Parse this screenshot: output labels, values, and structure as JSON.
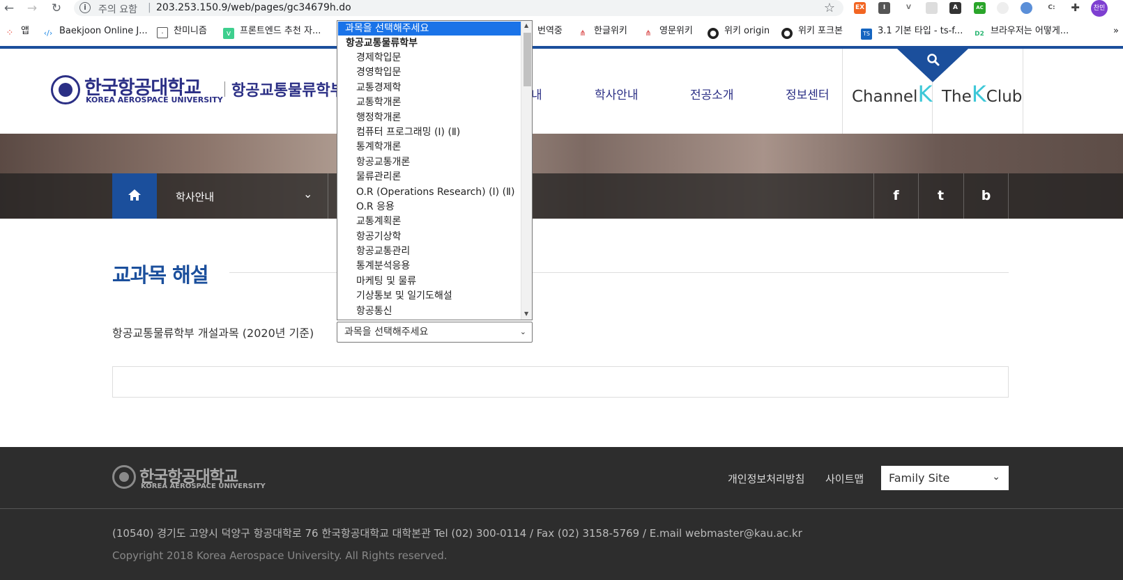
{
  "browser": {
    "security_warning": "주의 요함",
    "separator": "|",
    "url": "203.253.150.9/web/pages/gc34679h.do",
    "profile_label": "찬민",
    "extensions": [
      "EX",
      "I",
      "V",
      "",
      "A",
      "AC",
      "",
      "",
      "C:",
      ""
    ],
    "bookmarks": [
      {
        "label": "앱",
        "icon": "apps-grid-icon"
      },
      {
        "label": "Baekjoon Online J...",
        "icon": "code-bracket-icon"
      },
      {
        "label": "찬미니즘",
        "icon": "face-icon"
      },
      {
        "label": "프론트엔드 추천 자...",
        "icon": "v-badge-icon"
      },
      {
        "label": "번역중",
        "icon": "none"
      },
      {
        "label": "한글위키",
        "icon": "wiki-tree-icon"
      },
      {
        "label": "영문위키",
        "icon": "wiki-tree-icon"
      },
      {
        "label": "위키 origin",
        "icon": "github-icon"
      },
      {
        "label": "위키 포크본",
        "icon": "github-icon"
      },
      {
        "label": "3.1 기본 타입 - ts-f...",
        "icon": "ts-icon"
      },
      {
        "label": "브라우저는 어떻게...",
        "icon": "d2-icon"
      }
    ],
    "bookmarks_more": "»"
  },
  "header": {
    "logo_kr": "한국항공대학교",
    "logo_en": "KOREA AEROSPACE UNIVERSITY",
    "dept_title": "항공교통물류학부",
    "nav_partial": "내",
    "nav": [
      "학사안내",
      "전공소개",
      "정보센터"
    ],
    "channel_k": {
      "pre": "Channel",
      "k": "K",
      "post": ""
    },
    "the_k_club": {
      "pre": "The",
      "k": "K",
      "post": "Club"
    }
  },
  "breadcrumb": {
    "current": "학사안내",
    "sns": [
      "f",
      "t",
      "b"
    ]
  },
  "content": {
    "page_title": "교과목 해설",
    "course_label": "항공교통물류학부 개설과목 (2020년 기준)",
    "select_value": "과목을 선택해주세요"
  },
  "dropdown": {
    "highlighted": "과목을 선택해주세요",
    "group": "항공교통물류학부",
    "options": [
      "경제학입문",
      "경영학입문",
      "교통경제학",
      "교통학개론",
      "행정학개론",
      "컴퓨터 프로그래밍 (Ⅰ) (Ⅱ)",
      "통계학개론",
      "항공교통개론",
      "물류관리론",
      "O.R (Operations Research) (Ⅰ) (Ⅱ)",
      "O.R 응용",
      "교통계획론",
      "항공기상학",
      "항공교통관리",
      "통계분석응용",
      "마케팅 및 물류",
      "기상통보 및 일기도해설",
      "항공통신"
    ]
  },
  "footer": {
    "logo_kr": "한국항공대학교",
    "logo_en": "KOREA AEROSPACE UNIVERSITY",
    "privacy": "개인정보처리방침",
    "sitemap": "사이트맵",
    "family_site": "Family Site",
    "address": "(10540) 경기도 고양시 덕양구 항공대학로 76 한국항공대학교 대학본관 Tel (02) 300-0114 / Fax (02) 3158-5769 / E.mail webmaster@kau.ac.kr",
    "copyright": "Copyright 2018 Korea Aerospace University. All Rights reserved."
  },
  "colors": {
    "brand_navy": "#2b2f85",
    "brand_blue": "#1b4f9c",
    "select_highlight": "#1a73e8",
    "accent_cyan": "#3ec8d8",
    "footer_bg": "#2d2d2d"
  }
}
